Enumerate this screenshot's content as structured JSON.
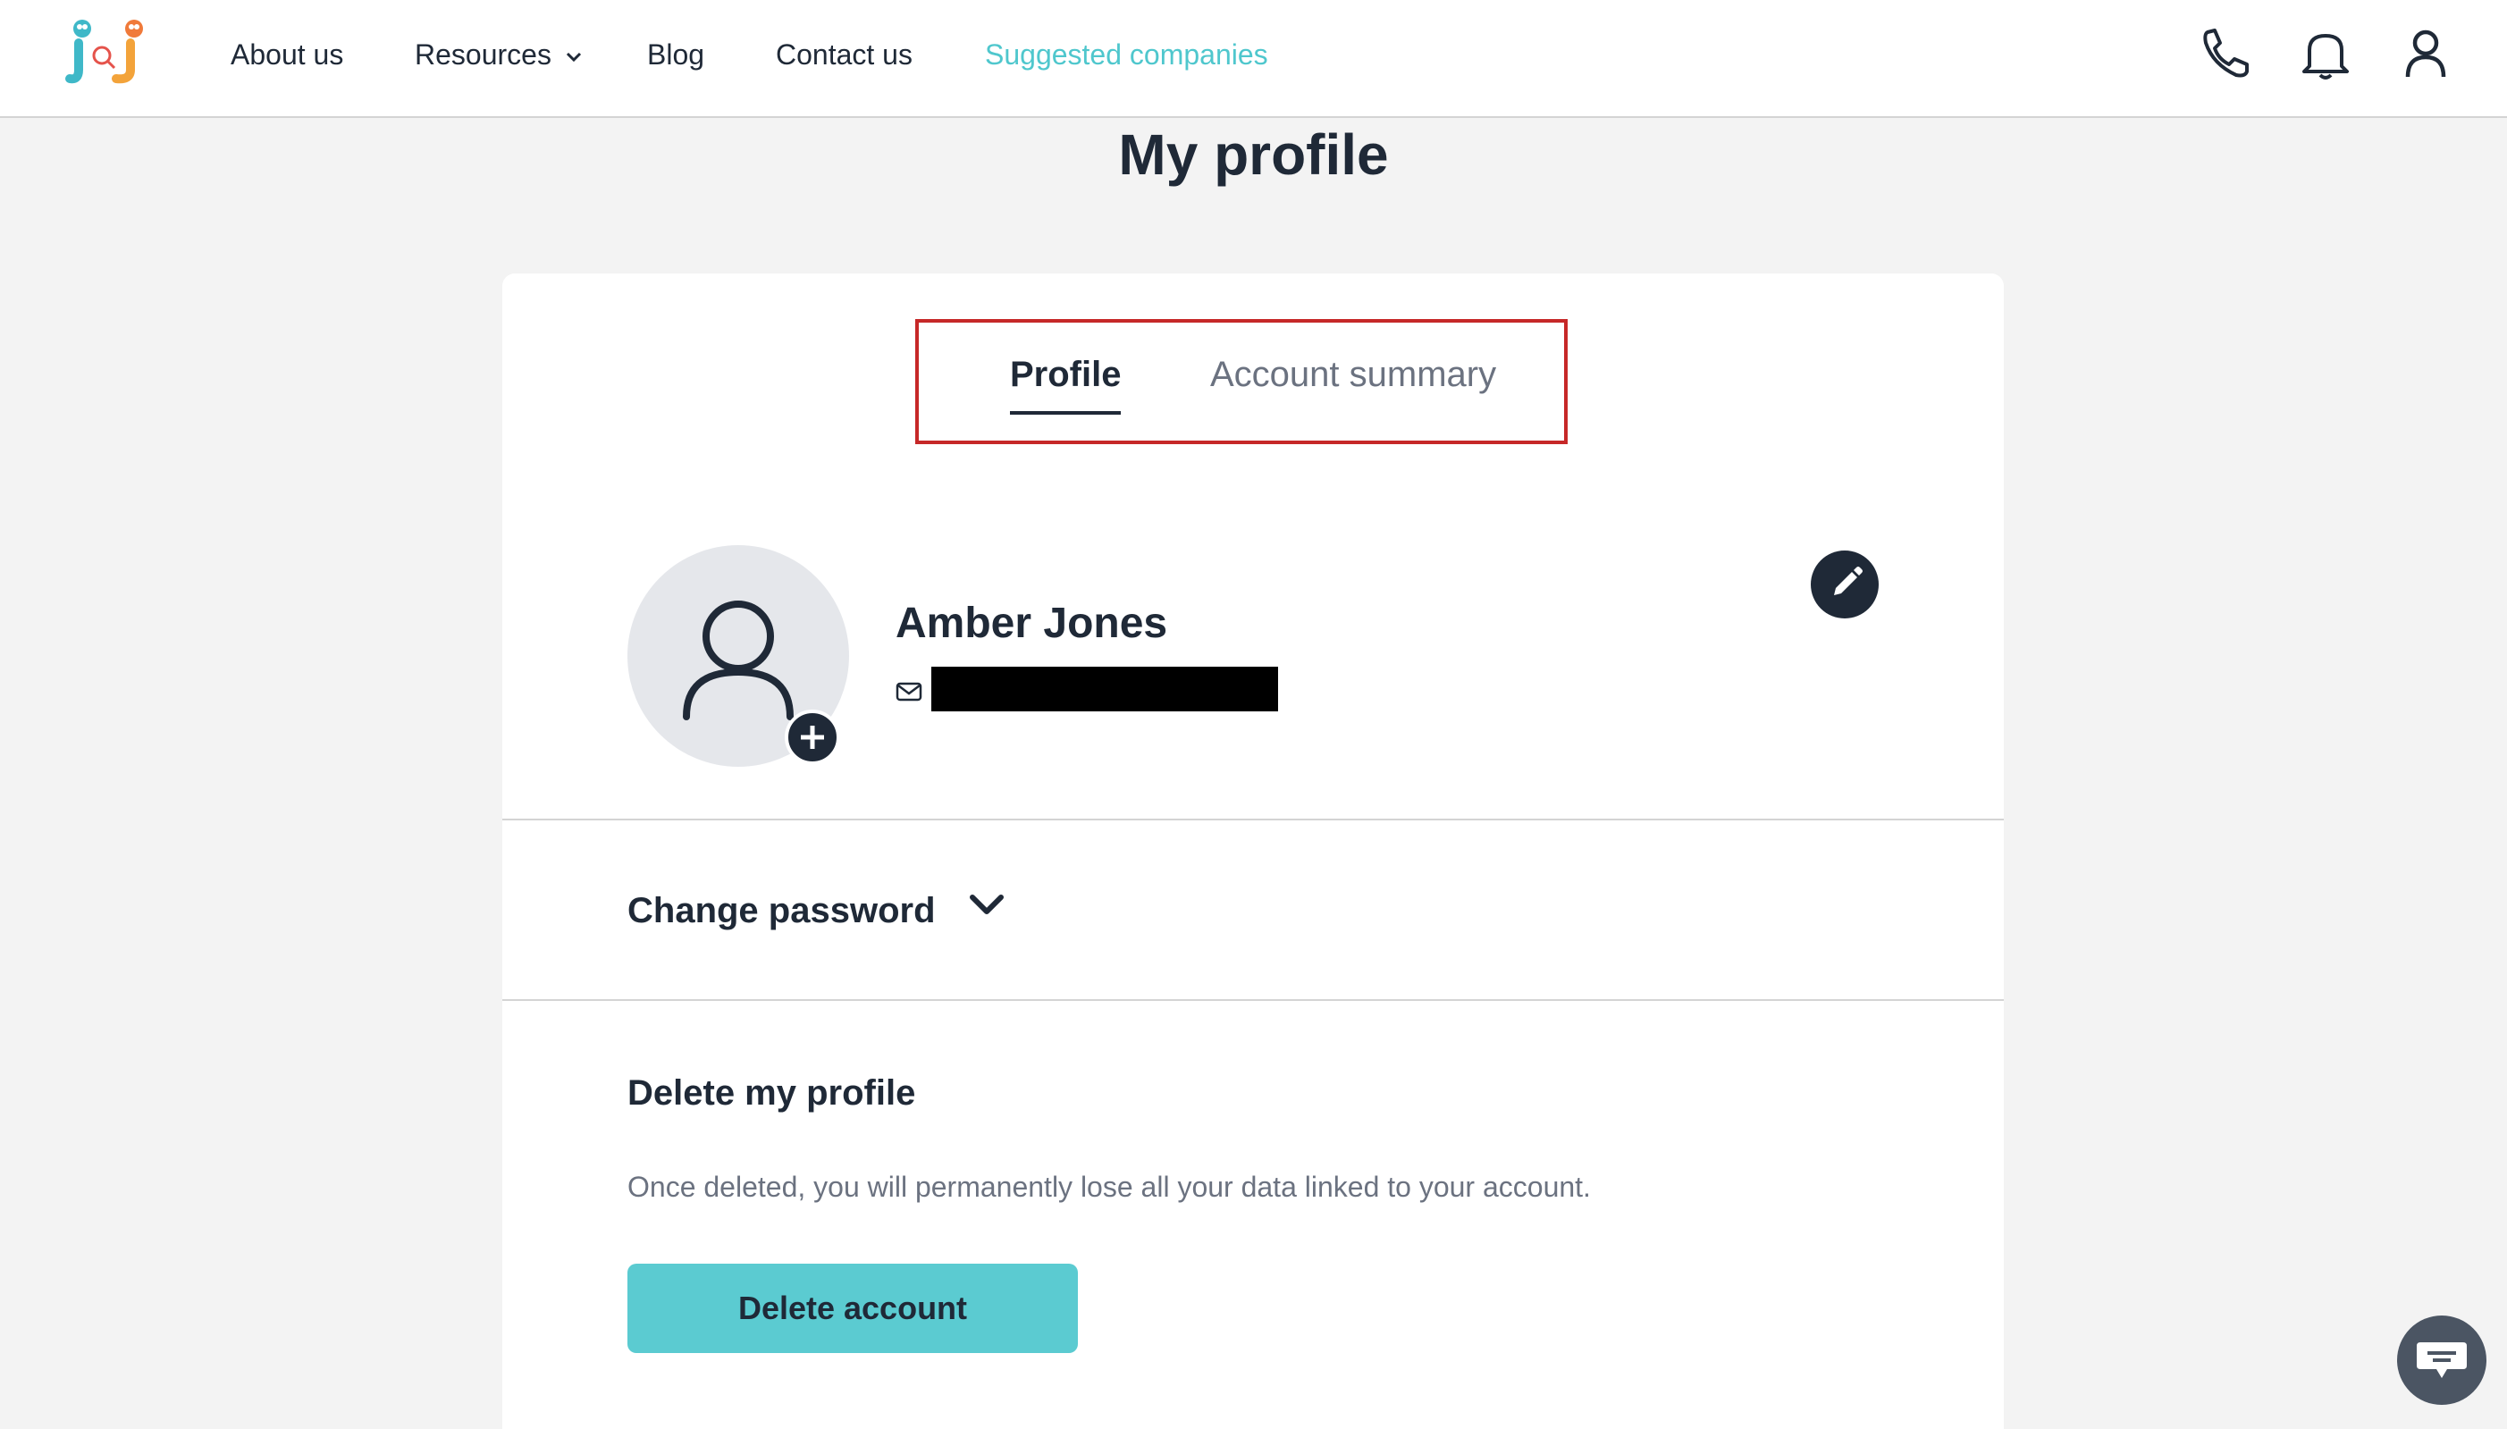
{
  "nav": {
    "items": [
      {
        "label": "About us"
      },
      {
        "label": "Resources"
      },
      {
        "label": "Blog"
      },
      {
        "label": "Contact us"
      },
      {
        "label": "Suggested companies",
        "active": true
      }
    ],
    "icons": [
      "phone-icon",
      "bell-icon",
      "user-icon"
    ]
  },
  "page": {
    "title": "My profile"
  },
  "tabs": [
    {
      "label": "Profile",
      "selected": true
    },
    {
      "label": "Account summary",
      "selected": false
    }
  ],
  "profile": {
    "name": "Amber Jones"
  },
  "password": {
    "heading": "Change password"
  },
  "delete": {
    "heading": "Delete my profile",
    "description": "Once deleted, you will permanently lose all your data linked to your account.",
    "button_label": "Delete account"
  },
  "colors": {
    "accent": "#4fc7cd",
    "button": "#5bcbd1",
    "dark": "#1f2937",
    "highlight": "#c62828"
  }
}
